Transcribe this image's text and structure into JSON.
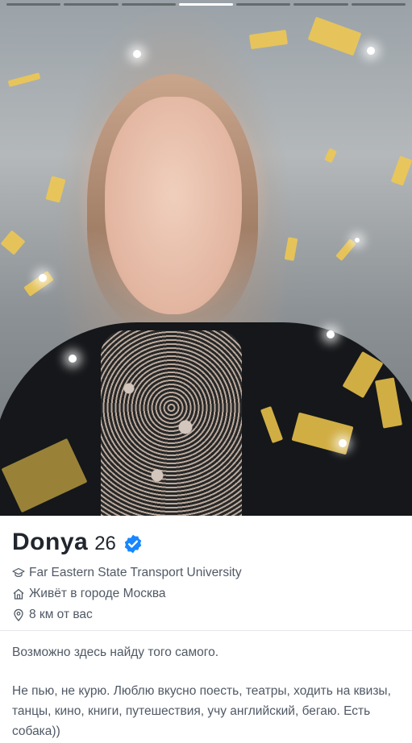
{
  "photo_progress": {
    "count": 7,
    "active_index": 3
  },
  "profile": {
    "name": "Donya",
    "age": "26",
    "verified": true,
    "school": "Far Eastern State Transport University",
    "lives_in": "Живёт в городе Москва",
    "distance": "8 км от вас"
  },
  "bio": {
    "line1": "Возможно здесь найду того самого.",
    "paragraph2": "Не пью, не курю. Люблю вкусно поесть, театры, ходить на квизы, танцы, кино, книги, путешествия, учу английский, бегаю. Есть собака))"
  },
  "icons": {
    "verified": "verified-badge-icon",
    "school": "graduation-cap-icon",
    "home": "home-icon",
    "location": "location-pin-icon"
  },
  "colors": {
    "verified": "#1786ff",
    "text": "#21262e",
    "muted": "#505965"
  }
}
